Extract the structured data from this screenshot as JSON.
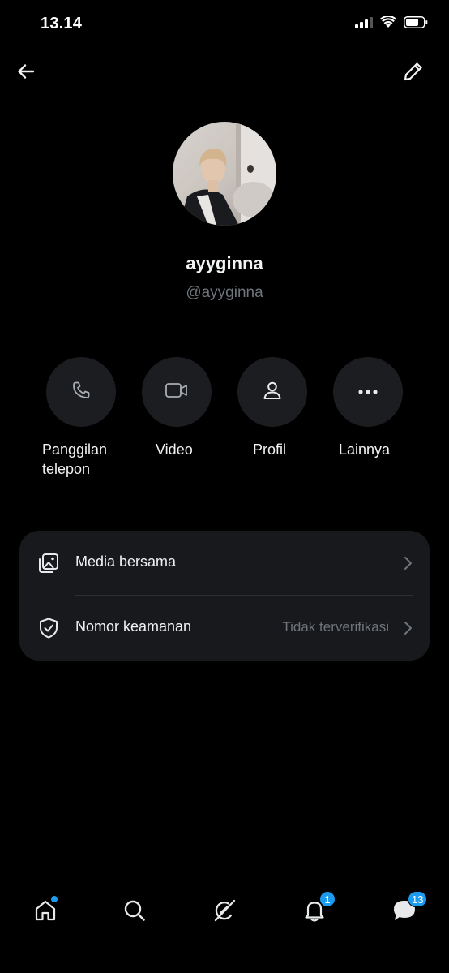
{
  "status_bar": {
    "time": "13.14",
    "icons": [
      "signal-icon",
      "wifi-icon",
      "battery-icon"
    ]
  },
  "header": {
    "back_icon": "arrow-left-icon",
    "edit_icon": "pencil-icon"
  },
  "profile": {
    "display_name": "ayyginna",
    "handle": "@ayyginna"
  },
  "actions": [
    {
      "label": "Panggilan\ntelepon",
      "icon": "phone-icon"
    },
    {
      "label": "Video",
      "icon": "video-icon"
    },
    {
      "label": "Profil",
      "icon": "person-icon"
    },
    {
      "label": "Lainnya",
      "icon": "more-icon"
    }
  ],
  "settings": {
    "media": {
      "label": "Media bersama",
      "icon": "media-icon"
    },
    "security": {
      "label": "Nomor keamanan",
      "value": "Tidak terverifikasi",
      "icon": "shield-icon"
    }
  },
  "bottom_nav": {
    "items": [
      "home-icon",
      "search-icon",
      "grok-icon",
      "bell-icon",
      "messages-icon"
    ],
    "notifications_badge": "1",
    "messages_badge": "13"
  },
  "colors": {
    "background": "#000000",
    "surface": "#1c1d20",
    "card": "#18191c",
    "text_primary": "#f1f2f3",
    "text_secondary": "#6f757b",
    "accent": "#1d9bf0"
  }
}
